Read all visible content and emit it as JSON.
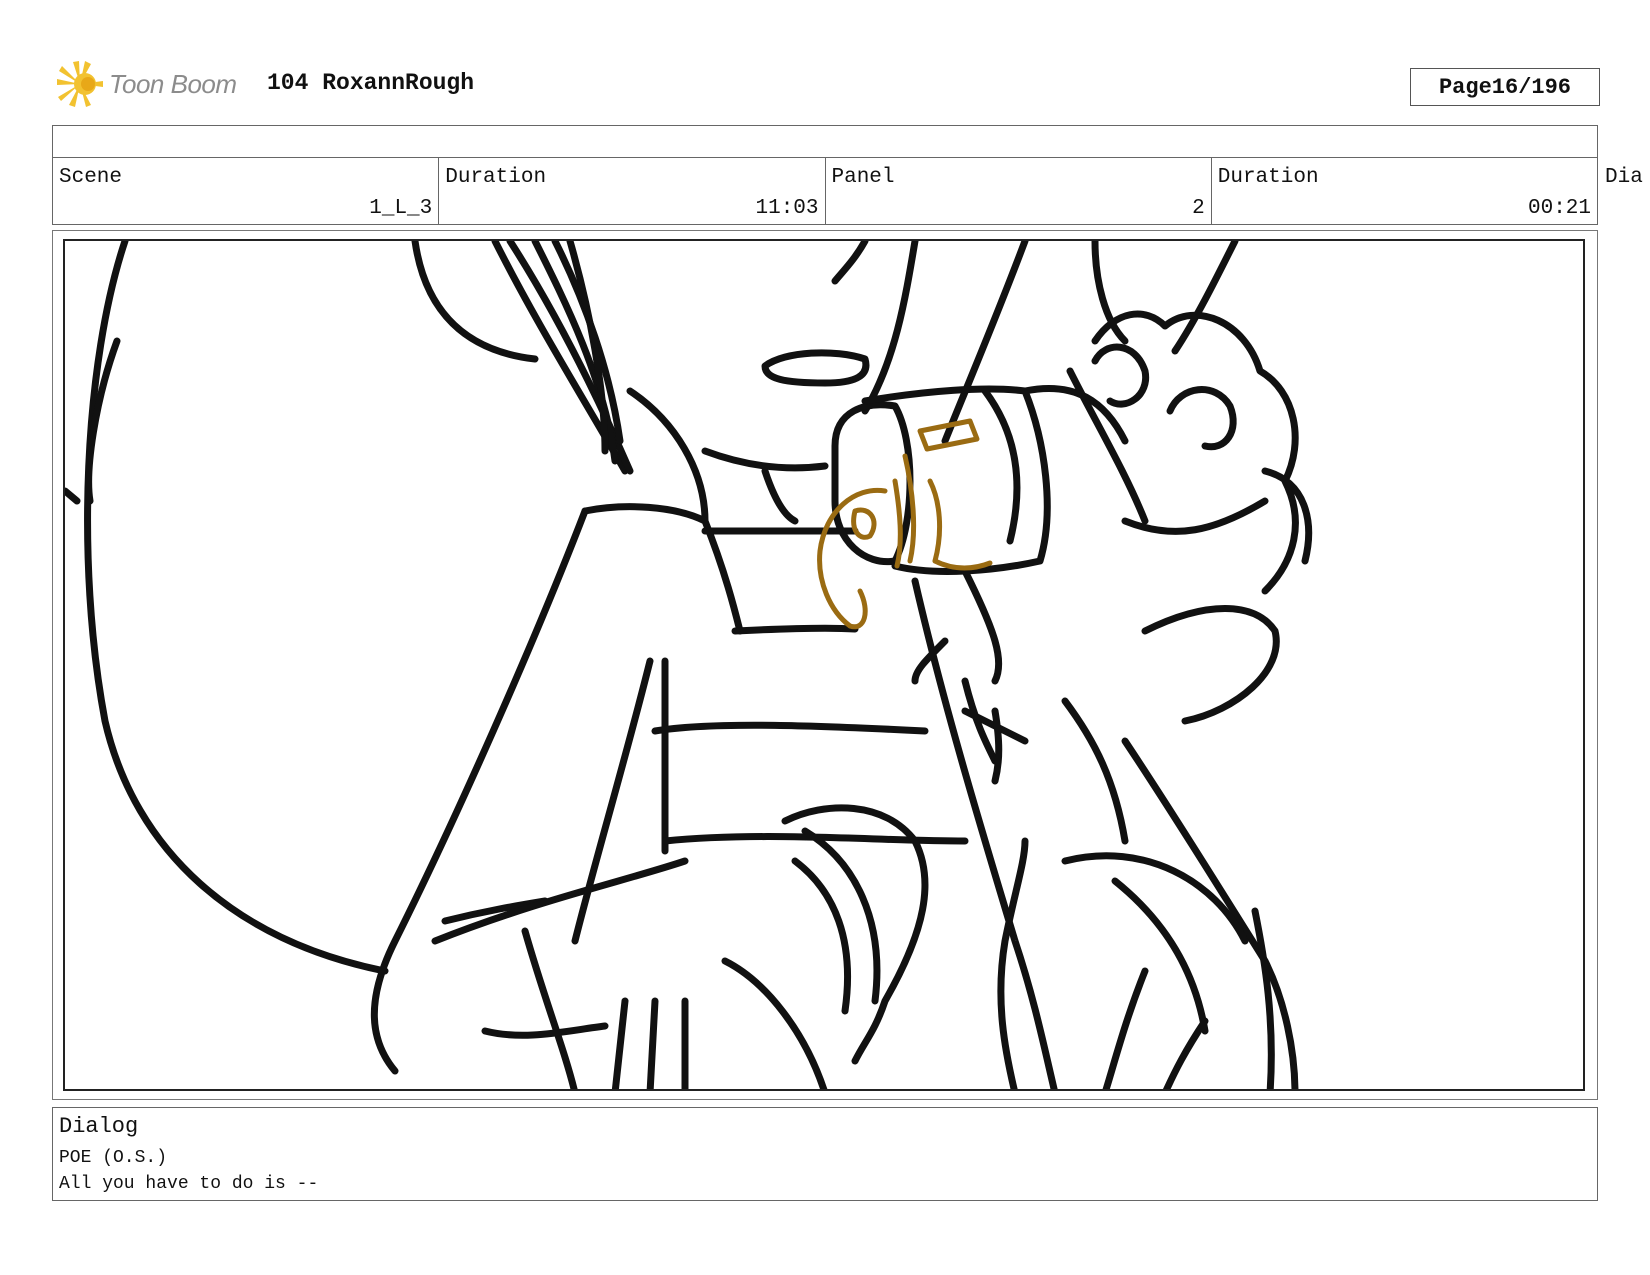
{
  "header": {
    "logo_text": "Toon Boom",
    "logo_icon": "starburst-logo-icon",
    "project_title": "104 RoxannRough",
    "page_label": "Page",
    "page_number": "16/196"
  },
  "info": {
    "scene_label": "Scene",
    "scene_value": "1_L_3",
    "scene_duration_label": "Duration",
    "scene_duration_value": "11:03",
    "panel_label": "Panel",
    "panel_value": "2",
    "panel_duration_label": "Duration",
    "panel_duration_value": "00:21",
    "overflow_label": "Dia"
  },
  "colors": {
    "line": "#111111",
    "accent_ochre": "#9a6b12",
    "logo_yellow": "#f2c230",
    "frame": "#666666"
  },
  "dialog": {
    "label": "Dialog",
    "speaker": "POE (O.S.)",
    "line": "All you have to do is --"
  }
}
